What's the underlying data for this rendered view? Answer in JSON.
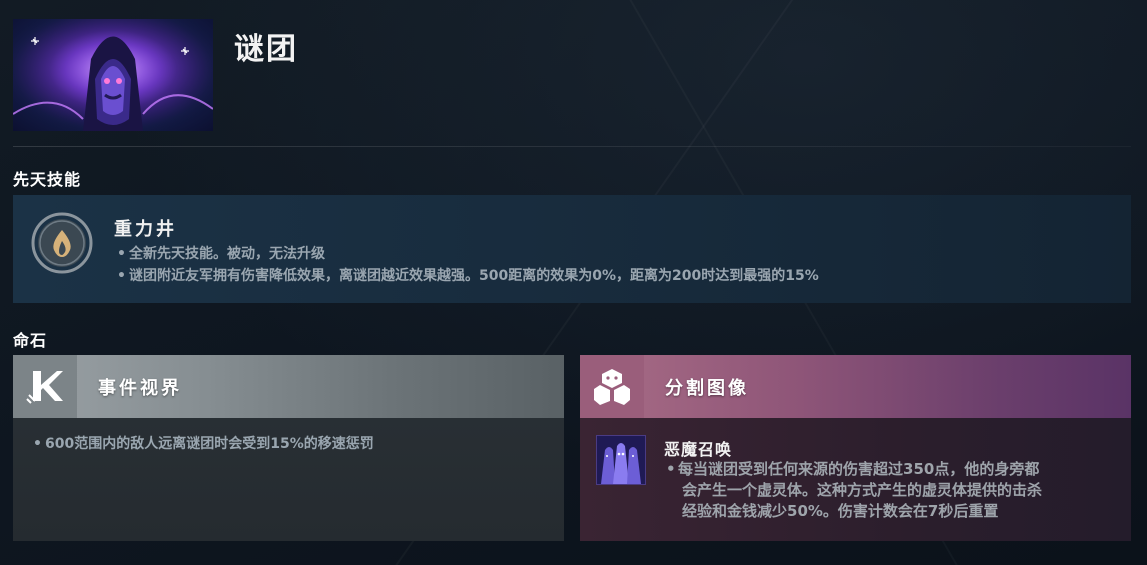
{
  "hero": {
    "name": "谜团"
  },
  "innate": {
    "section_title": "先天技能",
    "icon": "gravity-well-icon",
    "title": "重力井",
    "lines": [
      "全新先天技能。被动，无法升级",
      "谜团附近友军拥有伤害降低效果，离谜团越近效果越强。500距离的效果为0%，距离为200时达到最强的15%"
    ]
  },
  "facets": {
    "section_title": "命石",
    "left": {
      "icon": "event-horizon-icon",
      "title": "事件视界",
      "color": "#868e92",
      "description": "600范围内的敌人远离谜团时会受到15%的移速惩罚"
    },
    "right": {
      "icon": "split-image-icon",
      "title": "分割图像",
      "color": "#8e5578",
      "ability": {
        "icon": "demonic-summoning-icon",
        "name": "恶魔召唤",
        "description_lines": [
          "每当谜团受到任何来源的伤害超过350点，他的身旁都",
          "会产生一个虚灵体。这种方式产生的虚灵体提供的击杀",
          "经验和金钱减少50%。伤害计数会在7秒后重置"
        ]
      }
    }
  }
}
